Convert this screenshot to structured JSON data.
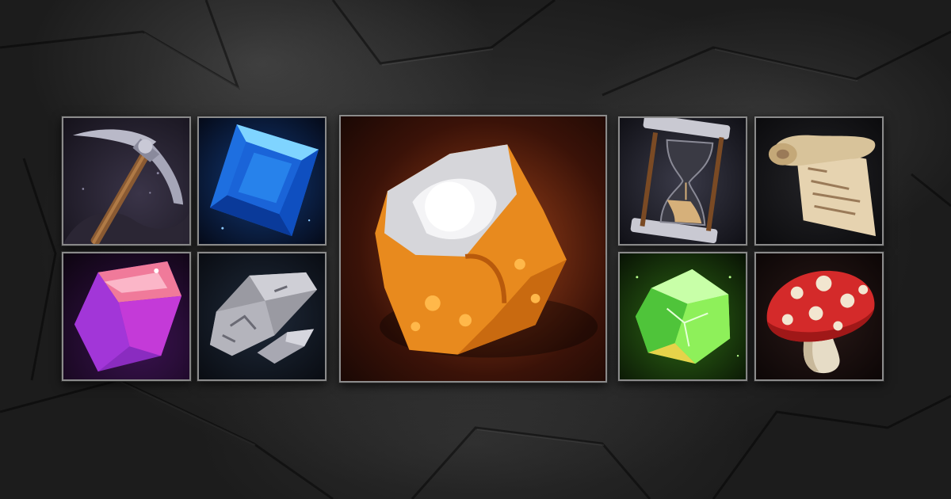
{
  "inventory": {
    "items": [
      {
        "name": "pickaxe",
        "icon": "pickaxe-icon"
      },
      {
        "name": "blue-gem",
        "icon": "blue-gem-icon"
      },
      {
        "name": "purple-crystal",
        "icon": "purple-crystal-icon"
      },
      {
        "name": "stone-ore",
        "icon": "stone-ore-icon"
      },
      {
        "name": "amber-ore",
        "icon": "amber-ore-icon"
      },
      {
        "name": "hourglass",
        "icon": "hourglass-icon"
      },
      {
        "name": "scroll",
        "icon": "scroll-icon"
      },
      {
        "name": "green-gem",
        "icon": "green-gem-icon"
      },
      {
        "name": "mushroom",
        "icon": "mushroom-icon"
      }
    ]
  },
  "colors": {
    "slot_border": "#8b8b8b",
    "background": "#2a2a2a",
    "blue_gem": "#1e6fe0",
    "purple_crystal": "#a236d8",
    "green_gem": "#6ee04a",
    "amber": "#e88a1e",
    "mushroom_red": "#d42a2a"
  }
}
